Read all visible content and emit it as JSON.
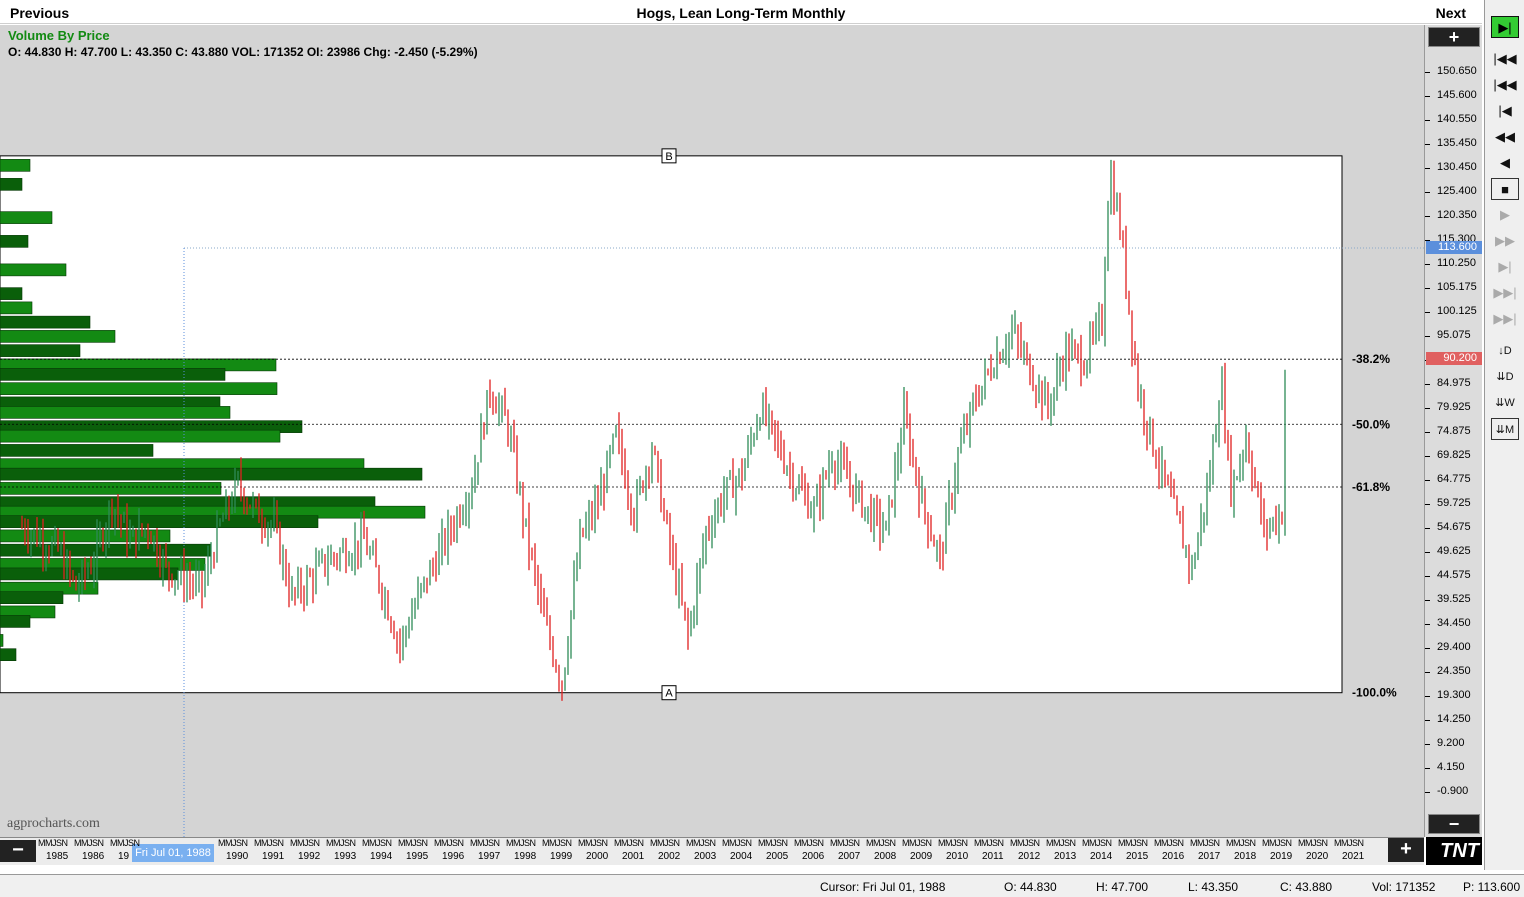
{
  "header": {
    "prev_label": "Previous",
    "title": "Hogs, Lean Long-Term Monthly",
    "next_label": "Next"
  },
  "info": {
    "study_label": "Volume By Price",
    "ohlc_text": "O: 44.830  H: 47.700  L: 43.350  C: 43.880 VOL: 171352 OI: 23986 Chg: -2.450 (-5.29%)"
  },
  "watermark": "agprocharts.com",
  "markers": {
    "top": "B",
    "bottom": "A"
  },
  "colors": {
    "up": "#2e8b57",
    "down": "#e02020",
    "vbp_dark": "#0a5f0a",
    "vbp_light": "#138a13",
    "price_box": "#e06060",
    "cursor_box": "#5b8fdc"
  },
  "y_axis": {
    "ticks": [
      "150.650",
      "145.600",
      "140.550",
      "135.450",
      "130.450",
      "125.400",
      "120.350",
      "115.300",
      "110.250",
      "105.175",
      "100.125",
      "95.075",
      "90.025",
      "84.975",
      "79.925",
      "74.875",
      "69.825",
      "64.775",
      "59.725",
      "54.675",
      "49.625",
      "44.575",
      "39.525",
      "34.450",
      "29.400",
      "24.350",
      "19.300",
      "14.250",
      "9.200",
      "4.150",
      "-0.900"
    ],
    "cursor_price": "113.600",
    "last_price": "90.200",
    "plus_label": "+",
    "minus_label": "−"
  },
  "x_axis": {
    "years": [
      "1985",
      "1986",
      "19",
      "1990",
      "1991",
      "1992",
      "1993",
      "1994",
      "1995",
      "1996",
      "1997",
      "1998",
      "1999",
      "2000",
      "2001",
      "2002",
      "2003",
      "2004",
      "2005",
      "2006",
      "2007",
      "2008",
      "2009",
      "2010",
      "2011",
      "2012",
      "2013",
      "2014",
      "2015",
      "2016",
      "2017",
      "2018",
      "2019",
      "2020",
      "2021",
      "202"
    ],
    "month_marks": "MMJSN",
    "cursor_date": "Fri Jul 01, 1988",
    "minus_label": "−",
    "plus_label": "+"
  },
  "logo_text": "TNT",
  "right_panel": {
    "labels": [
      "D",
      "D",
      "W",
      "M"
    ]
  },
  "status": {
    "cursor": "Cursor: Fri Jul 01, 1988",
    "open": "O: 44.830",
    "high": "H: 47.700",
    "low": "L: 43.350",
    "close": "C: 43.880",
    "vol": "Vol: 171352",
    "price": "P: 113.600"
  },
  "chart_data": {
    "type": "ohlc-bar",
    "title": "Hogs, Lean Long-Term Monthly",
    "study": "Volume By Price",
    "ylim": [
      -0.9,
      155
    ],
    "x_range": [
      1984,
      2022
    ],
    "grid": false,
    "fib_retracement": {
      "high": 133.0,
      "low": 20.0,
      "levels": [
        {
          "label": "-38.2%",
          "value": 90.2
        },
        {
          "label": "-50.0%",
          "value": 76.5
        },
        {
          "label": "-61.8%",
          "value": 63.3
        },
        {
          "label": "-100.0%",
          "value": 20.0
        }
      ]
    },
    "price_path": [
      [
        1984.0,
        55
      ],
      [
        1985.0,
        50
      ],
      [
        1985.5,
        42
      ],
      [
        1986.0,
        48
      ],
      [
        1986.5,
        60
      ],
      [
        1987.0,
        52
      ],
      [
        1987.5,
        55
      ],
      [
        1988.0,
        46
      ],
      [
        1988.5,
        44
      ],
      [
        1989.0,
        42
      ],
      [
        1989.5,
        55
      ],
      [
        1990.0,
        64
      ],
      [
        1990.5,
        58
      ],
      [
        1991.0,
        55
      ],
      [
        1991.5,
        40
      ],
      [
        1992.0,
        44
      ],
      [
        1992.5,
        48
      ],
      [
        1993.0,
        50
      ],
      [
        1993.5,
        52
      ],
      [
        1994.0,
        42
      ],
      [
        1994.5,
        30
      ],
      [
        1995.0,
        40
      ],
      [
        1995.5,
        48
      ],
      [
        1996.0,
        56
      ],
      [
        1996.5,
        64
      ],
      [
        1997.0,
        84
      ],
      [
        1997.5,
        76
      ],
      [
        1998.0,
        54
      ],
      [
        1998.5,
        35
      ],
      [
        1999.0,
        22
      ],
      [
        1999.5,
        52
      ],
      [
        2000.0,
        60
      ],
      [
        2000.5,
        74
      ],
      [
        2001.0,
        58
      ],
      [
        2001.5,
        72
      ],
      [
        2002.0,
        50
      ],
      [
        2002.5,
        32
      ],
      [
        2003.0,
        54
      ],
      [
        2003.5,
        62
      ],
      [
        2004.0,
        66
      ],
      [
        2004.5,
        80
      ],
      [
        2005.0,
        72
      ],
      [
        2005.5,
        64
      ],
      [
        2006.0,
        58
      ],
      [
        2006.5,
        70
      ],
      [
        2007.0,
        64
      ],
      [
        2007.5,
        58
      ],
      [
        2008.0,
        54
      ],
      [
        2008.5,
        78
      ],
      [
        2009.0,
        60
      ],
      [
        2009.5,
        48
      ],
      [
        2010.0,
        70
      ],
      [
        2010.5,
        82
      ],
      [
        2011.0,
        90
      ],
      [
        2011.5,
        96
      ],
      [
        2012.0,
        88
      ],
      [
        2012.5,
        80
      ],
      [
        2013.0,
        92
      ],
      [
        2013.5,
        90
      ],
      [
        2014.0,
        98
      ],
      [
        2014.2,
        130
      ],
      [
        2014.5,
        118
      ],
      [
        2015.0,
        84
      ],
      [
        2015.5,
        70
      ],
      [
        2016.0,
        58
      ],
      [
        2016.5,
        46
      ],
      [
        2017.0,
        66
      ],
      [
        2017.3,
        86
      ],
      [
        2017.6,
        62
      ],
      [
        2018.0,
        74
      ],
      [
        2018.5,
        54
      ],
      [
        2019.0,
        58
      ],
      [
        2019.1,
        90.2
      ]
    ],
    "volume_by_price": [
      {
        "price": 131,
        "volume": 30
      },
      {
        "price": 127,
        "volume": 22
      },
      {
        "price": 120,
        "volume": 52
      },
      {
        "price": 115,
        "volume": 28
      },
      {
        "price": 109,
        "volume": 66
      },
      {
        "price": 104,
        "volume": 22
      },
      {
        "price": 101,
        "volume": 32
      },
      {
        "price": 98,
        "volume": 90
      },
      {
        "price": 95,
        "volume": 115
      },
      {
        "price": 92,
        "volume": 80
      },
      {
        "price": 89,
        "volume": 276
      },
      {
        "price": 87,
        "volume": 225
      },
      {
        "price": 84,
        "volume": 277
      },
      {
        "price": 81,
        "volume": 220
      },
      {
        "price": 79,
        "volume": 230
      },
      {
        "price": 76,
        "volume": 302
      },
      {
        "price": 74,
        "volume": 280
      },
      {
        "price": 71,
        "volume": 153
      },
      {
        "price": 68,
        "volume": 364
      },
      {
        "price": 66,
        "volume": 422
      },
      {
        "price": 63,
        "volume": 221
      },
      {
        "price": 60,
        "volume": 375
      },
      {
        "price": 58,
        "volume": 425
      },
      {
        "price": 56,
        "volume": 318
      },
      {
        "price": 53,
        "volume": 170
      },
      {
        "price": 50,
        "volume": 211
      },
      {
        "price": 47,
        "volume": 205
      },
      {
        "price": 45,
        "volume": 178
      },
      {
        "price": 42,
        "volume": 98
      },
      {
        "price": 40,
        "volume": 63
      },
      {
        "price": 37,
        "volume": 55
      },
      {
        "price": 35,
        "volume": 30
      },
      {
        "price": 31,
        "volume": 3
      },
      {
        "price": 28,
        "volume": 16
      }
    ],
    "cursor": {
      "date": "Fri Jul 01, 1988",
      "price": 113.6
    }
  }
}
